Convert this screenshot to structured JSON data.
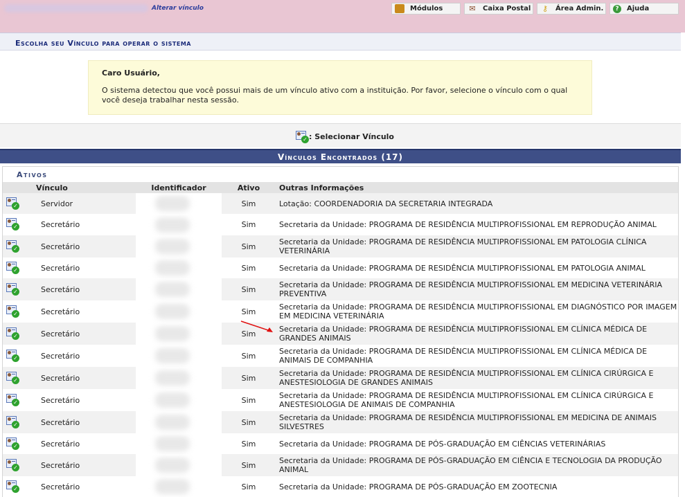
{
  "topbar": {
    "alterar_label": "Alterar vínculo",
    "buttons": [
      {
        "label": "Módulos",
        "icon": "modules-icon"
      },
      {
        "label": "Caixa Postal",
        "icon": "mailbox-icon"
      },
      {
        "label": "Área Admin.",
        "icon": "key-icon"
      },
      {
        "label": "Ajuda",
        "icon": "help-icon"
      }
    ]
  },
  "page_title": "Escolha seu Vínculo para operar o sistema",
  "notice": {
    "heading": "Caro Usuário,",
    "text": "O sistema detectou que você possui mais de um vínculo ativo com a instituição. Por favor, selecione o vínculo com o qual você deseja trabalhar nesta sessão."
  },
  "legend": {
    "label": ": Selecionar Vínculo"
  },
  "section_header": "Vínculos Encontrados (17)",
  "group_title": "Ativos",
  "columns": [
    "Vínculo",
    "Identificador",
    "Ativo",
    "Outras Informações"
  ],
  "rows": [
    {
      "vinculo": "Servidor",
      "ativo": "Sim",
      "info": "Lotação: COORDENADORIA DA SECRETARIA INTEGRADA"
    },
    {
      "vinculo": "Secretário",
      "ativo": "Sim",
      "info": "Secretaria da Unidade: PROGRAMA DE RESIDÊNCIA MULTIPROFISSIONAL EM REPRODUÇÃO ANIMAL"
    },
    {
      "vinculo": "Secretário",
      "ativo": "Sim",
      "info": "Secretaria da Unidade: PROGRAMA DE RESIDÊNCIA MULTIPROFISSIONAL EM PATOLOGIA CLÍNICA VETERINÁRIA"
    },
    {
      "vinculo": "Secretário",
      "ativo": "Sim",
      "info": "Secretaria da Unidade: PROGRAMA DE RESIDÊNCIA MULTIPROFISSIONAL EM PATOLOGIA ANIMAL"
    },
    {
      "vinculo": "Secretário",
      "ativo": "Sim",
      "info": "Secretaria da Unidade: PROGRAMA DE RESIDÊNCIA MULTIPROFISSIONAL EM MEDICINA VETERINÁRIA PREVENTIVA"
    },
    {
      "vinculo": "Secretário",
      "ativo": "Sim",
      "info": "Secretaria da Unidade: PROGRAMA DE RESIDÊNCIA MULTIPROFISSIONAL EM DIAGNÓSTICO POR IMAGEM EM MEDICINA VETERINÁRIA"
    },
    {
      "vinculo": "Secretário",
      "ativo": "Sim",
      "info": "Secretaria da Unidade: PROGRAMA DE RESIDÊNCIA MULTIPROFISSIONAL EM CLÍNICA MÉDICA DE GRANDES ANIMAIS"
    },
    {
      "vinculo": "Secretário",
      "ativo": "Sim",
      "info": "Secretaria da Unidade: PROGRAMA DE RESIDÊNCIA MULTIPROFISSIONAL EM CLÍNICA MÉDICA DE ANIMAIS DE COMPANHIA"
    },
    {
      "vinculo": "Secretário",
      "ativo": "Sim",
      "info": "Secretaria da Unidade: PROGRAMA DE RESIDÊNCIA MULTIPROFISSIONAL EM CLÍNICA CIRÚRGICA E ANESTESIOLOGIA DE GRANDES ANIMAIS"
    },
    {
      "vinculo": "Secretário",
      "ativo": "Sim",
      "info": "Secretaria da Unidade: PROGRAMA DE RESIDÊNCIA MULTIPROFISSIONAL EM CLÍNICA CIRÚRGICA E ANESTESIOLOGIA DE ANIMAIS DE COMPANHIA"
    },
    {
      "vinculo": "Secretário",
      "ativo": "Sim",
      "info": "Secretaria da Unidade: PROGRAMA DE RESIDÊNCIA MULTIPROFISSIONAL EM MEDICINA DE ANIMAIS SILVESTRES"
    },
    {
      "vinculo": "Secretário",
      "ativo": "Sim",
      "info": "Secretaria da Unidade: PROGRAMA DE PÓS-GRADUAÇÃO EM CIÊNCIAS VETERINÁRIAS"
    },
    {
      "vinculo": "Secretário",
      "ativo": "Sim",
      "info": "Secretaria da Unidade: PROGRAMA DE PÓS-GRADUAÇÃO EM CIÊNCIA E TECNOLOGIA DA PRODUÇÃO ANIMAL"
    },
    {
      "vinculo": "Secretário",
      "ativo": "Sim",
      "info": "Secretaria da Unidade: PROGRAMA DE PÓS-GRADUAÇÃO EM ZOOTECNIA"
    }
  ]
}
